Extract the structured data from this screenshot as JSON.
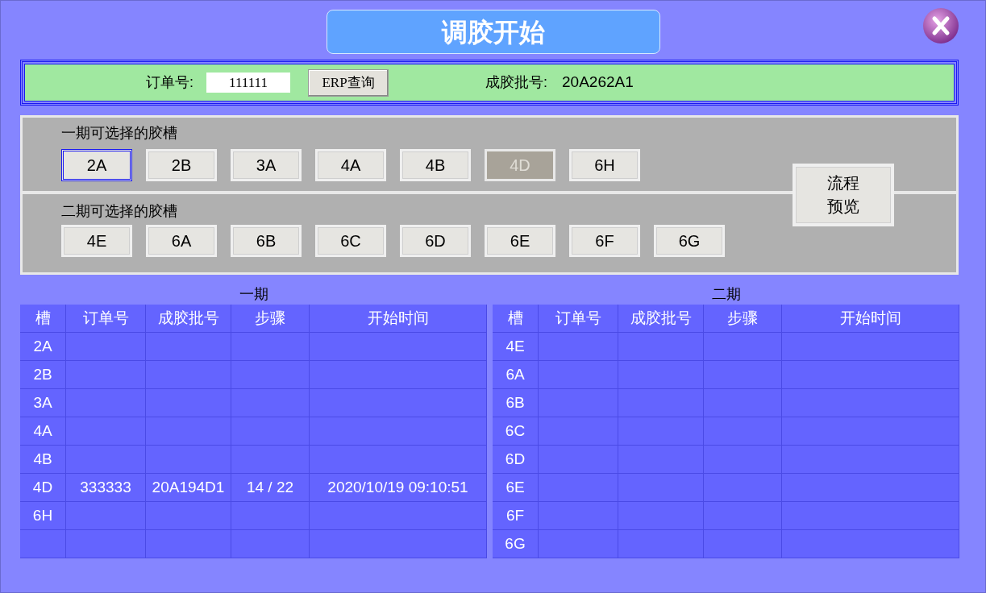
{
  "window": {
    "title": "调胶开始"
  },
  "order_bar": {
    "order_label": "订单号:",
    "order_value": "111111",
    "erp_button": "ERP查询",
    "batch_label": "成胶批号:",
    "batch_value": "20A262A1"
  },
  "phase1_slots": {
    "label": "一期可选择的胶槽",
    "slots": [
      {
        "label": "2A",
        "selected": true,
        "disabled": false
      },
      {
        "label": "2B",
        "selected": false,
        "disabled": false
      },
      {
        "label": "3A",
        "selected": false,
        "disabled": false
      },
      {
        "label": "4A",
        "selected": false,
        "disabled": false
      },
      {
        "label": "4B",
        "selected": false,
        "disabled": false
      },
      {
        "label": "4D",
        "selected": false,
        "disabled": true
      },
      {
        "label": "6H",
        "selected": false,
        "disabled": false
      }
    ]
  },
  "phase2_slots": {
    "label": "二期可选择的胶槽",
    "slots": [
      {
        "label": "4E",
        "selected": false,
        "disabled": false
      },
      {
        "label": "6A",
        "selected": false,
        "disabled": false
      },
      {
        "label": "6B",
        "selected": false,
        "disabled": false
      },
      {
        "label": "6C",
        "selected": false,
        "disabled": false
      },
      {
        "label": "6D",
        "selected": false,
        "disabled": false
      },
      {
        "label": "6E",
        "selected": false,
        "disabled": false
      },
      {
        "label": "6F",
        "selected": false,
        "disabled": false
      },
      {
        "label": "6G",
        "selected": false,
        "disabled": false
      }
    ]
  },
  "preview_button": [
    "流程",
    "预览"
  ],
  "tables": [
    {
      "title": "一期",
      "columns": [
        "槽",
        "订单号",
        "成胶批号",
        "步骤",
        "开始时间"
      ],
      "rows": [
        {
          "cells": [
            "2A"
          ]
        },
        {
          "cells": [
            "2B"
          ]
        },
        {
          "cells": [
            "3A"
          ]
        },
        {
          "cells": [
            "4A"
          ]
        },
        {
          "cells": [
            "4B"
          ]
        },
        {
          "cells": [
            "4D",
            "333333",
            "20A194D1",
            "14 / 22",
            "2020/10/19 09:10:51"
          ]
        },
        {
          "cells": [
            "6H"
          ]
        }
      ]
    },
    {
      "title": "二期",
      "columns": [
        "槽",
        "订单号",
        "成胶批号",
        "步骤",
        "开始时间"
      ],
      "rows": [
        {
          "cells": [
            "4E"
          ]
        },
        {
          "cells": [
            "6A"
          ]
        },
        {
          "cells": [
            "6B"
          ]
        },
        {
          "cells": [
            "6C"
          ]
        },
        {
          "cells": [
            "6D"
          ]
        },
        {
          "cells": [
            "6E"
          ]
        },
        {
          "cells": [
            "6F"
          ]
        },
        {
          "cells": [
            "6G"
          ]
        }
      ]
    }
  ]
}
